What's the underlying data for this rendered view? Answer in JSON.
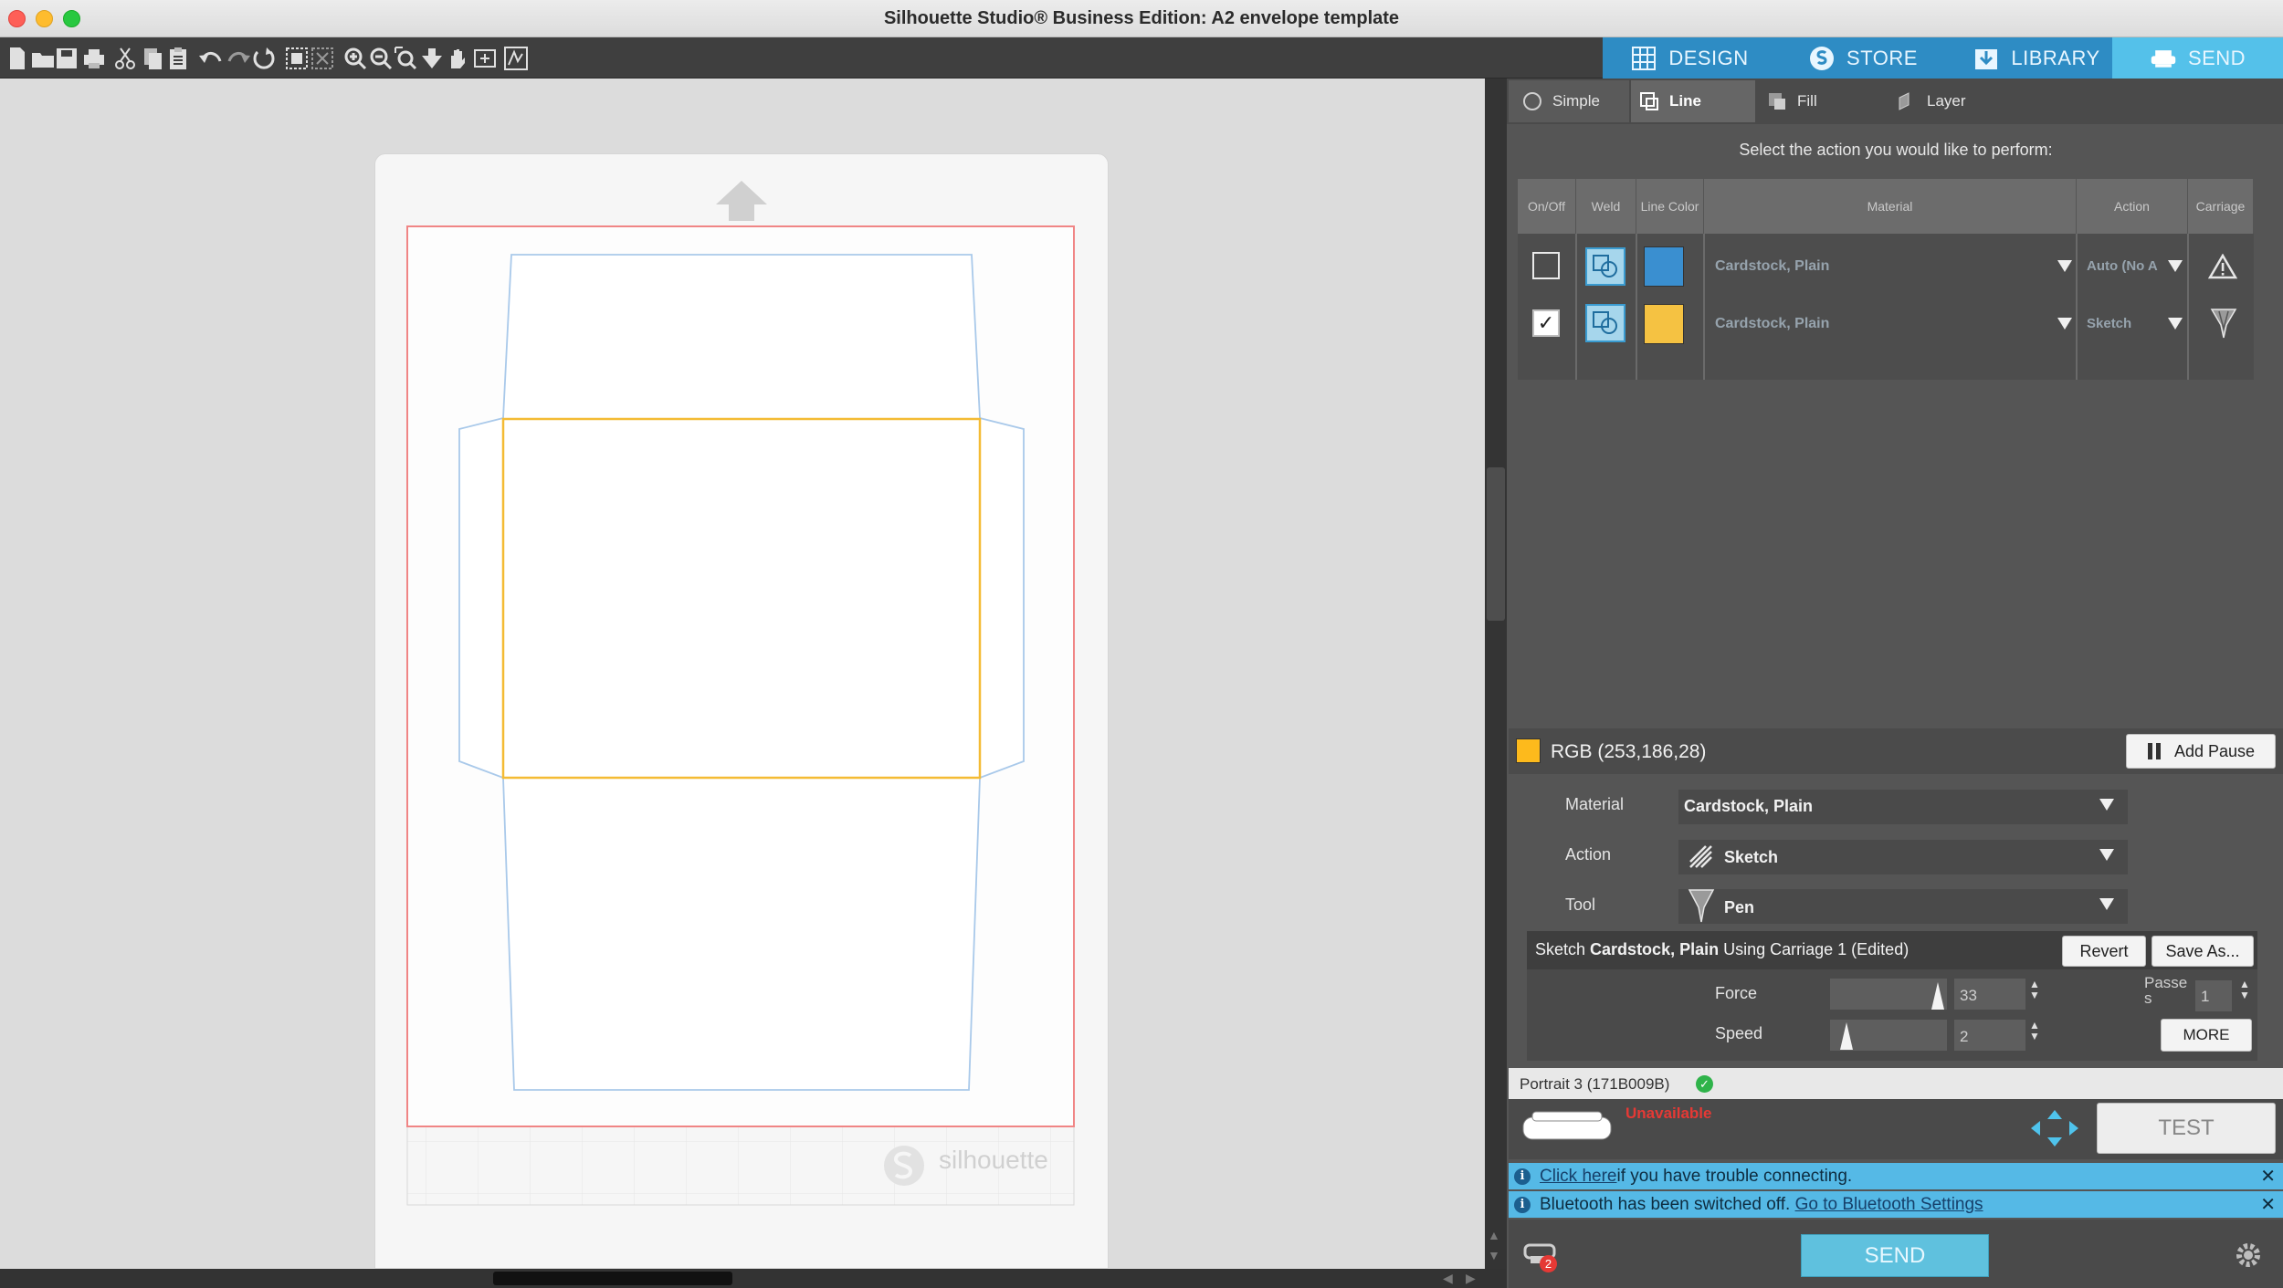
{
  "window": {
    "title": "Silhouette Studio® Business Edition: A2 envelope template"
  },
  "toolbar_icons": [
    "new-document-icon",
    "open-folder-icon",
    "save-icon",
    "print-icon",
    "cut-icon",
    "copy-icon",
    "paste-icon",
    "undo-icon",
    "redo-icon",
    "redraw-icon",
    "select-all-icon",
    "deselect-icon",
    "zoom-in-icon",
    "zoom-out-icon",
    "zoom-fit-icon",
    "fit-to-page-icon",
    "pan-icon",
    "add-page-icon",
    "pixscan-icon"
  ],
  "nav_tabs": [
    {
      "label": "DESIGN",
      "icon": "grid-icon"
    },
    {
      "label": "STORE",
      "icon": "store-icon"
    },
    {
      "label": "LIBRARY",
      "icon": "library-icon"
    },
    {
      "label": "SEND",
      "icon": "send-printer-icon",
      "active": true
    }
  ],
  "send_tabs": [
    {
      "label": "Simple"
    },
    {
      "label": "Line",
      "active": true
    },
    {
      "label": "Fill"
    },
    {
      "label": "Layer"
    }
  ],
  "instruction": "Select the action you would like to perform:",
  "table": {
    "headers": [
      "On/Off",
      "Weld",
      "Line Color",
      "Material",
      "Action",
      "Carriage"
    ],
    "rows": [
      {
        "on": false,
        "color": "#3a8fd0",
        "material": "Cardstock, Plain",
        "action": "Auto (No A",
        "carriage_icon": "warning-icon"
      },
      {
        "on": true,
        "color": "#f5c242",
        "material": "Cardstock, Plain",
        "action": "Sketch",
        "carriage_icon": "pen-tool-icon"
      }
    ]
  },
  "selected": {
    "color_label": "RGB (253,186,28)",
    "swatch": "#fdba1c",
    "add_pause": "Add Pause",
    "material_label": "Material",
    "material_value": "Cardstock, Plain",
    "action_label": "Action",
    "action_value": "Sketch",
    "tool_label": "Tool",
    "tool_value": "Pen"
  },
  "settings": {
    "title_prefix": "Sketch",
    "title_bold": "Cardstock, Plain",
    "title_suffix": "Using Carriage 1 (Edited)",
    "revert": "Revert",
    "save_as": "Save As...",
    "force_label": "Force",
    "force_value": "33",
    "force_fraction": 0.97,
    "speed_label": "Speed",
    "speed_value": "2",
    "speed_fraction": 0.1,
    "passes_label_1": "Passe",
    "passes_label_2": "s",
    "passes_value": "1",
    "more": "MORE"
  },
  "device": {
    "name": "Portrait 3 (171B009B)",
    "status": "Unavailable",
    "test": "TEST"
  },
  "notices": [
    {
      "link": "Click here",
      "text": " if you have trouble connecting."
    },
    {
      "text": "Bluetooth has been switched off. ",
      "link": "Go to Bluetooth Settings"
    }
  ],
  "send_button": "SEND",
  "queue_badge": "2",
  "brand_watermark": "silhouette",
  "colors": {
    "accent": "#4fc3ec",
    "active_tab": "#54c1ea",
    "panel": "#555555",
    "send": "#5fc1de",
    "error": "#e53935"
  }
}
